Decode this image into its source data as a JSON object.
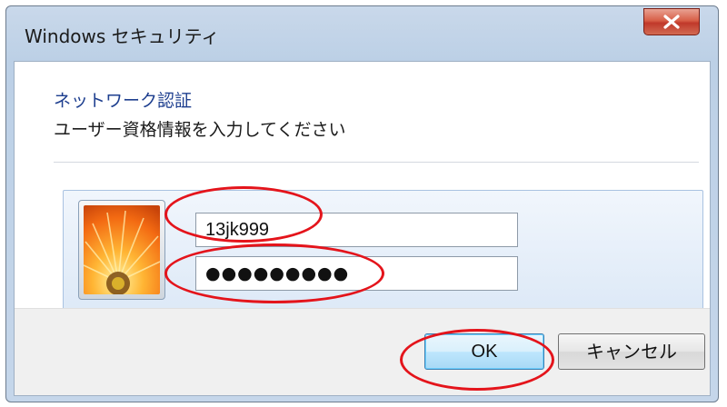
{
  "window": {
    "title": "Windows セキュリティ",
    "close_label": "close"
  },
  "dialog": {
    "heading": "ネットワーク認証",
    "subheading": "ユーザー資格情報を入力してください"
  },
  "credentials": {
    "avatar_icon": "user-avatar-flower-icon",
    "username": "13jk999",
    "password_mask": "●●●●●●●●●"
  },
  "buttons": {
    "ok_label": "OK",
    "cancel_label": "キャンセル"
  },
  "colors": {
    "annotation": "#e4141b",
    "heading": "#1e3f8f",
    "close_button": "#c0392b"
  }
}
